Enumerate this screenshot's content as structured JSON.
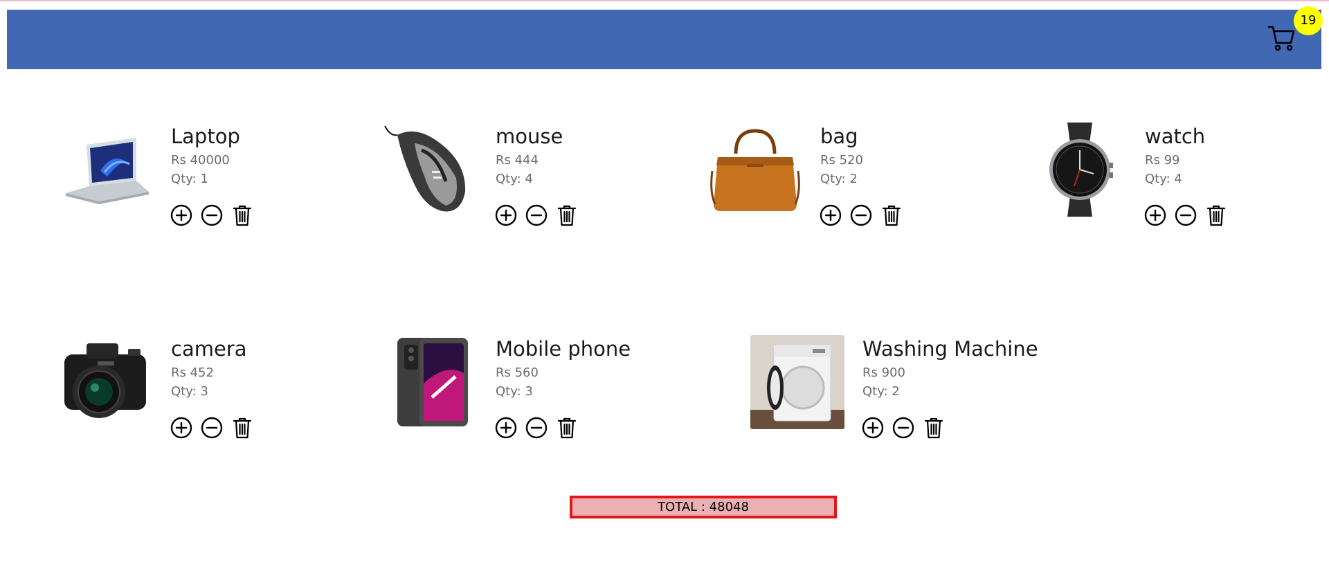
{
  "cart": {
    "count": "19"
  },
  "products": [
    {
      "name": "Laptop",
      "price": "Rs 40000",
      "qty": "Qty: 1",
      "image": "laptop-image"
    },
    {
      "name": "mouse",
      "price": "Rs 444",
      "qty": "Qty: 4",
      "image": "mouse-image"
    },
    {
      "name": "bag",
      "price": "Rs 520",
      "qty": "Qty: 2",
      "image": "bag-image"
    },
    {
      "name": "watch",
      "price": "Rs 99",
      "qty": "Qty: 4",
      "image": "watch-image"
    },
    {
      "name": "camera",
      "price": "Rs 452",
      "qty": "Qty: 3",
      "image": "camera-image"
    },
    {
      "name": "Mobile phone",
      "price": "Rs 560",
      "qty": "Qty: 3",
      "image": "mobile-phone-image"
    },
    {
      "name": "Washing Machine",
      "price": "Rs 900",
      "qty": "Qty: 2",
      "image": "washing-machine-image"
    }
  ],
  "total": {
    "label": "TOTAL : 48048"
  },
  "colors": {
    "header": "#4169b3",
    "badge": "#ffff00",
    "total_border": "#e3161b",
    "total_bg": "#ebb0b2"
  },
  "icons": [
    "cart-icon",
    "plus-circle-icon",
    "minus-circle-icon",
    "trash-icon"
  ]
}
